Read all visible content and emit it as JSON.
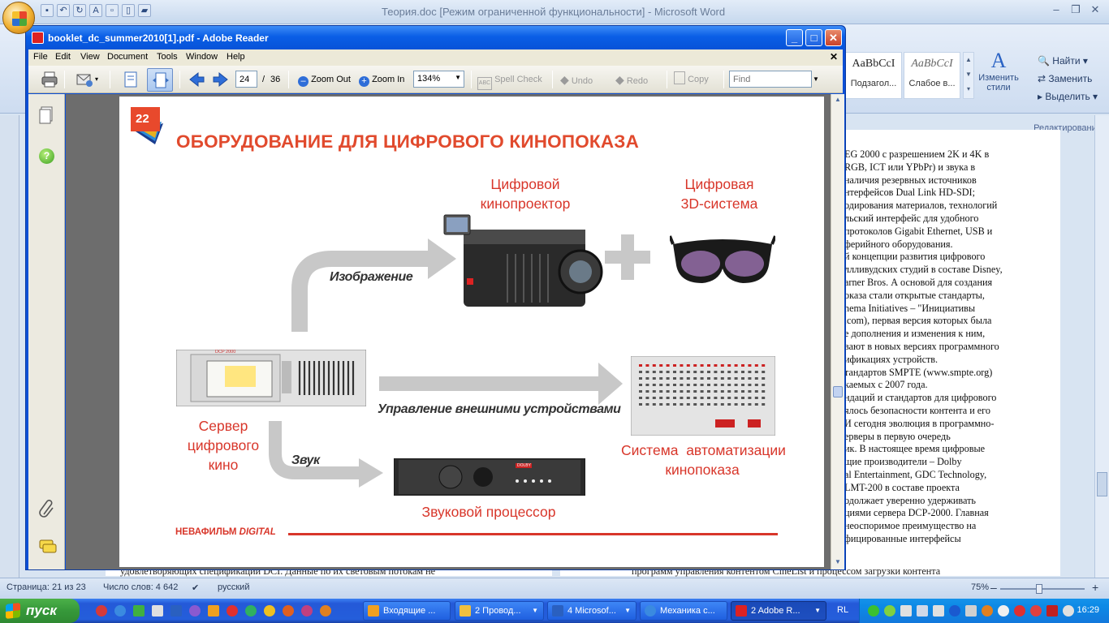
{
  "word": {
    "title": "Теория.doc [Режим ограниченной функциональности] - Microsoft Word",
    "styles": [
      {
        "sample": "AaBbCcI",
        "name": "Подзагол..."
      },
      {
        "sample": "AaBbCcI",
        "name": "Слабое в..."
      }
    ],
    "change_styles": "Изменить стили",
    "edit": {
      "find": "Найти",
      "replace": "Заменить",
      "select": "Выделить",
      "caption": "Редактирование"
    },
    "text_lines": [
      "EG 2000 с разрешением 2K и 4K в",
      "RGB, ICT или YPbPr) и звука в",
      "наличия резервных источников",
      "нтерфейсов Dual Link HD-SDI;",
      "одирования материалов, технологий",
      "льский интерфейс для удобного",
      "протоколов Gigabit Ethernet, USB и",
      "ферийного оборудования.",
      "й концепции развития цифрового",
      "ллливудских студий в составе Disney,",
      "arner Bros. А основой для создания",
      "оказа стали открытые стандарты,",
      "nema Initiatives – \"Инициативы",
      ".com), первая версия которых была",
      "",
      "е дополнения и изменения к ним,",
      "вают в новых версиях программного",
      "ификациях устройств.",
      "тандартов SMPTE (www.smpte.org)",
      "каемых с 2007 года.",
      "ндаций и стандартов для цифрового",
      "ялось безопасности контента и его",
      " И сегодня эволюция в программно-",
      "ерверы в первую очередь",
      "ик. В настоящее время цифровые",
      "щие производители – Dolby",
      "al Entertainment, GDC Technology,",
      "LMT-200 в составе проекта",
      "одолжает уверенно удерживать",
      "циями сервера DCP-2000. Главная",
      "неоспоримое преимущество на",
      "фицированные интерфейсы"
    ],
    "bottom_left": "удовлетворяющих спецификации DCI. Данные по их световым потокам не",
    "bottom_right": "программ управления контентом CineList и процессом загрузки контента",
    "status": {
      "page": "Страница: 21 из 23",
      "words": "Число слов: 4 642",
      "lang": "русский",
      "zoom": "75%"
    }
  },
  "reader": {
    "title": "booklet_dc_summer2010[1].pdf - Adobe Reader",
    "menu": [
      "File",
      "Edit",
      "View",
      "Document",
      "Tools",
      "Window",
      "Help"
    ],
    "toolbar": {
      "page_current": "24",
      "page_sep": "/",
      "page_total": "36",
      "zoom_out": "Zoom Out",
      "zoom_in": "Zoom In",
      "zoom_value": "134%",
      "spell_check": "Spell Check",
      "undo": "Undo",
      "redo": "Redo",
      "copy": "Copy",
      "find_placeholder": "Find"
    }
  },
  "pdf": {
    "page_number": "22",
    "heading": "ОБОРУДОВАНИЕ ДЛЯ ЦИФРОВОГО КИНОПОКАЗА",
    "projector_label": [
      "Цифровой",
      "кинопроектор"
    ],
    "system3d_label": [
      "Цифровая",
      "3D-система"
    ],
    "server_label": [
      "Сервер",
      "цифрового",
      "кино"
    ],
    "automation_label": [
      "Система  автоматизации",
      "кинопоказа"
    ],
    "sound_label": "Звуковой процессор",
    "arrow_image": "Изображение",
    "arrow_control": "Управление внешними устройствами",
    "arrow_sound": "Звук",
    "footer_brand": "НЕВАФИЛЬМ",
    "footer_brand_italic": "DIGITAL",
    "device_brand_server": "DCP 2000",
    "device_brand_sound": "DOLBY"
  },
  "taskbar": {
    "start": "пуск",
    "tasks": [
      "Входящие ...",
      "2 Провод...",
      "4 Microsof...",
      "Механика с...",
      "2 Adobe R..."
    ],
    "lang": "RL",
    "clock": "16:29"
  },
  "colors": {
    "pdf_red": "#d8362a",
    "heading_red": "#e14a2d",
    "reader_blue": "#0c4fd6",
    "taskbar_blue": "#245edb",
    "start_green": "#36983a"
  }
}
